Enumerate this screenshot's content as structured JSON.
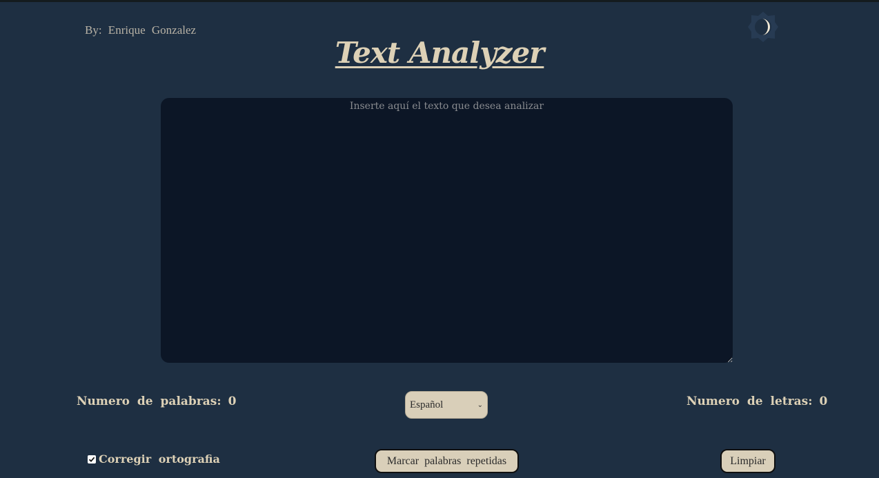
{
  "header": {
    "author": "By:  Enrique  Gonzalez",
    "title": "Text Analyzer",
    "theme_toggle_icon": "moon-icon"
  },
  "editor": {
    "placeholder": "Inserte aquí el texto que desea analizar",
    "value": ""
  },
  "stats": {
    "words_label": "Numero  de  palabras:",
    "words_value": "0",
    "letters_label": "Numero  de  letras:",
    "letters_value": "0"
  },
  "language": {
    "selected": "Español"
  },
  "controls": {
    "spellcheck_label": "Corregir  ortografia",
    "spellcheck_checked": true,
    "mark_repeated_label": "Marcar  palabras  repetidas",
    "clear_label": "Limpiar"
  },
  "colors": {
    "background": "#1e2f42",
    "editor_background": "#0c1626",
    "accent_text": "#ddd1b6",
    "button_background": "#d9cfb9"
  }
}
